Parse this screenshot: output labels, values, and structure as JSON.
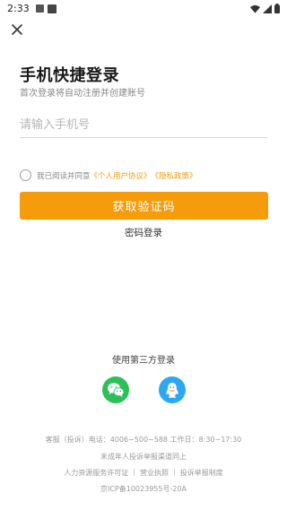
{
  "status_bar": {
    "time": "2:33"
  },
  "title": "手机快捷登录",
  "subtitle": "首次登录将自动注册并创建账号",
  "phone_input": {
    "placeholder": "请输入手机号",
    "value": ""
  },
  "agreement": {
    "prefix": "我已阅读并同意",
    "user_agreement": "《个人用户协议》",
    "privacy_policy": "《隐私政策》"
  },
  "get_code_button": "获取验证码",
  "password_login": "密码登录",
  "third_party": {
    "label": "使用第三方登录",
    "icons": [
      "wechat-icon",
      "qq-icon"
    ]
  },
  "footer": {
    "service": "客服（投诉）电话：4006−500−588 工作日：8:30−17:30",
    "minor": "未成年人投诉举报渠道同上",
    "links": [
      "人力资源服务许可证",
      "营业执照",
      "投诉举报制度"
    ],
    "icp": "京ICP备10023955号-20A"
  },
  "colors": {
    "accent": "#f59c0b",
    "link": "#f29a0b",
    "wechat": "#2cc05a",
    "qq": "#2ea7f3"
  }
}
